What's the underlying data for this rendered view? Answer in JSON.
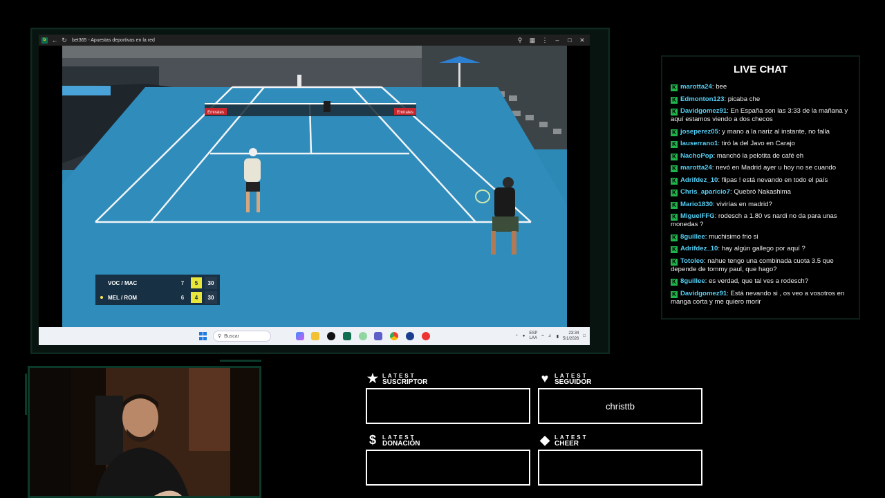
{
  "browser": {
    "tab_title": "bet365 - Apuestas deportivas en la red",
    "favicon_text": "b"
  },
  "scoreboard": {
    "rows": [
      {
        "team": "VOC / MAC",
        "set": "7",
        "game": "5",
        "points": "30",
        "serving": false
      },
      {
        "team": "MEL / ROM",
        "set": "6",
        "game": "4",
        "points": "30",
        "serving": true
      }
    ]
  },
  "court": {
    "banner_left": "Emirates",
    "banner_right": "Emirates"
  },
  "taskbar": {
    "search_placeholder": "Buscar",
    "lang_top": "ESP",
    "lang_bottom": "LAA",
    "time": "23:34",
    "date": "5/1/2026"
  },
  "chat": {
    "title": "LIVE CHAT",
    "badge_letter": "K",
    "messages": [
      {
        "user": "marotta24",
        "text": "bee"
      },
      {
        "user": "Edmonton123",
        "text": "picaba che"
      },
      {
        "user": "Davidgomez91",
        "text": "En España son las 3:33 de la mañana y aquí estamos viendo a dos checos"
      },
      {
        "user": "joseperez05",
        "text": "y mano a la nariz al instante, no falla"
      },
      {
        "user": "lauserrano1",
        "text": "tiró la del Javo en Carajo"
      },
      {
        "user": "NachoPop",
        "text": "manchó la pelotita de café eh"
      },
      {
        "user": "marotta24",
        "text": "nevó en Madrid ayer u hoy no se cuando"
      },
      {
        "user": "Adrifdez_10",
        "text": "flipas ! está nevando en todo el país"
      },
      {
        "user": "Chris_aparicio7",
        "text": "Quebró Nakashima"
      },
      {
        "user": "Mario1830",
        "text": "vivirías en madrid?"
      },
      {
        "user": "MiguelFFG",
        "text": "rodesch a 1.80 vs nardi no da para unas monedas ?"
      },
      {
        "user": "8guillee",
        "text": "muchisimo frio si"
      },
      {
        "user": "Adrifdez_10",
        "text": "hay algún gallego por aquí ?"
      },
      {
        "user": "Totoleo",
        "text": "nahue tengo una combinada cuota 3.5 que depende de tommy paul, que hago?"
      },
      {
        "user": "8guillee",
        "text": "es verdad, que tal ves a rodesch?"
      },
      {
        "user": "Davidgomez91",
        "text": "Está nevando si , os veo a vosotros en manga corta y me quiero morir"
      }
    ]
  },
  "widgets": {
    "suscriptor": {
      "small": "LATEST",
      "big": "SUSCRIPTOR",
      "value": ""
    },
    "seguidor": {
      "small": "LATEST",
      "big": "SEGUIDOR",
      "value": "christtb"
    },
    "donacion": {
      "small": "LATEST",
      "big": "DONACIÓN",
      "value": "",
      "icon": "$"
    },
    "cheer": {
      "small": "LATEST",
      "big": "CHEER",
      "value": ""
    }
  },
  "colors": {
    "court_blue": "#2e8cb8",
    "chat_user": "#55cff5",
    "chat_badge": "#21b34b",
    "frame_green": "#0c3a2a"
  }
}
